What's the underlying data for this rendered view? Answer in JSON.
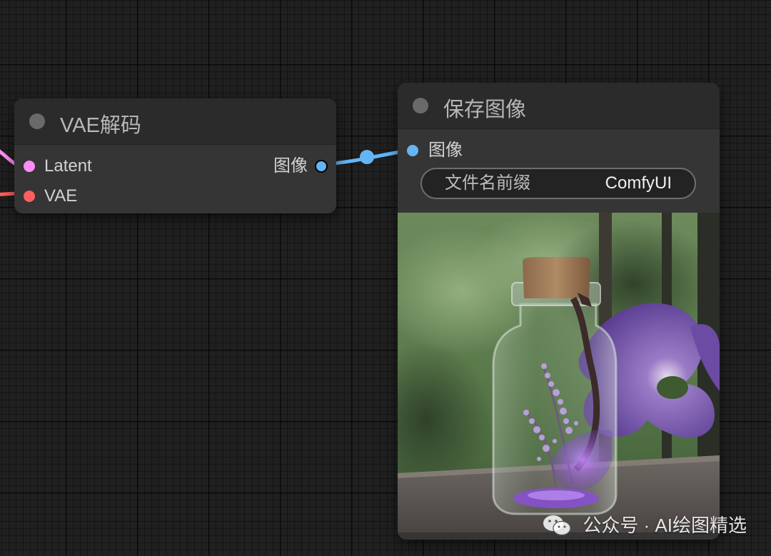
{
  "vae_decode_node": {
    "title": "VAE解码",
    "inputs": [
      {
        "label": "Latent",
        "color": "#ff8df5"
      },
      {
        "label": "VAE",
        "color": "#ff5e5e"
      }
    ],
    "output": {
      "label": "图像",
      "color": "#64b5f6"
    }
  },
  "save_image_node": {
    "title": "保存图像",
    "input": {
      "label": "图像",
      "color": "#64b5f6"
    },
    "widget": {
      "label": "文件名前缀",
      "value": "ComfyUI"
    }
  },
  "watermark": {
    "icon": "wechat-icon",
    "text": "公众号 · AI绘图精选"
  }
}
